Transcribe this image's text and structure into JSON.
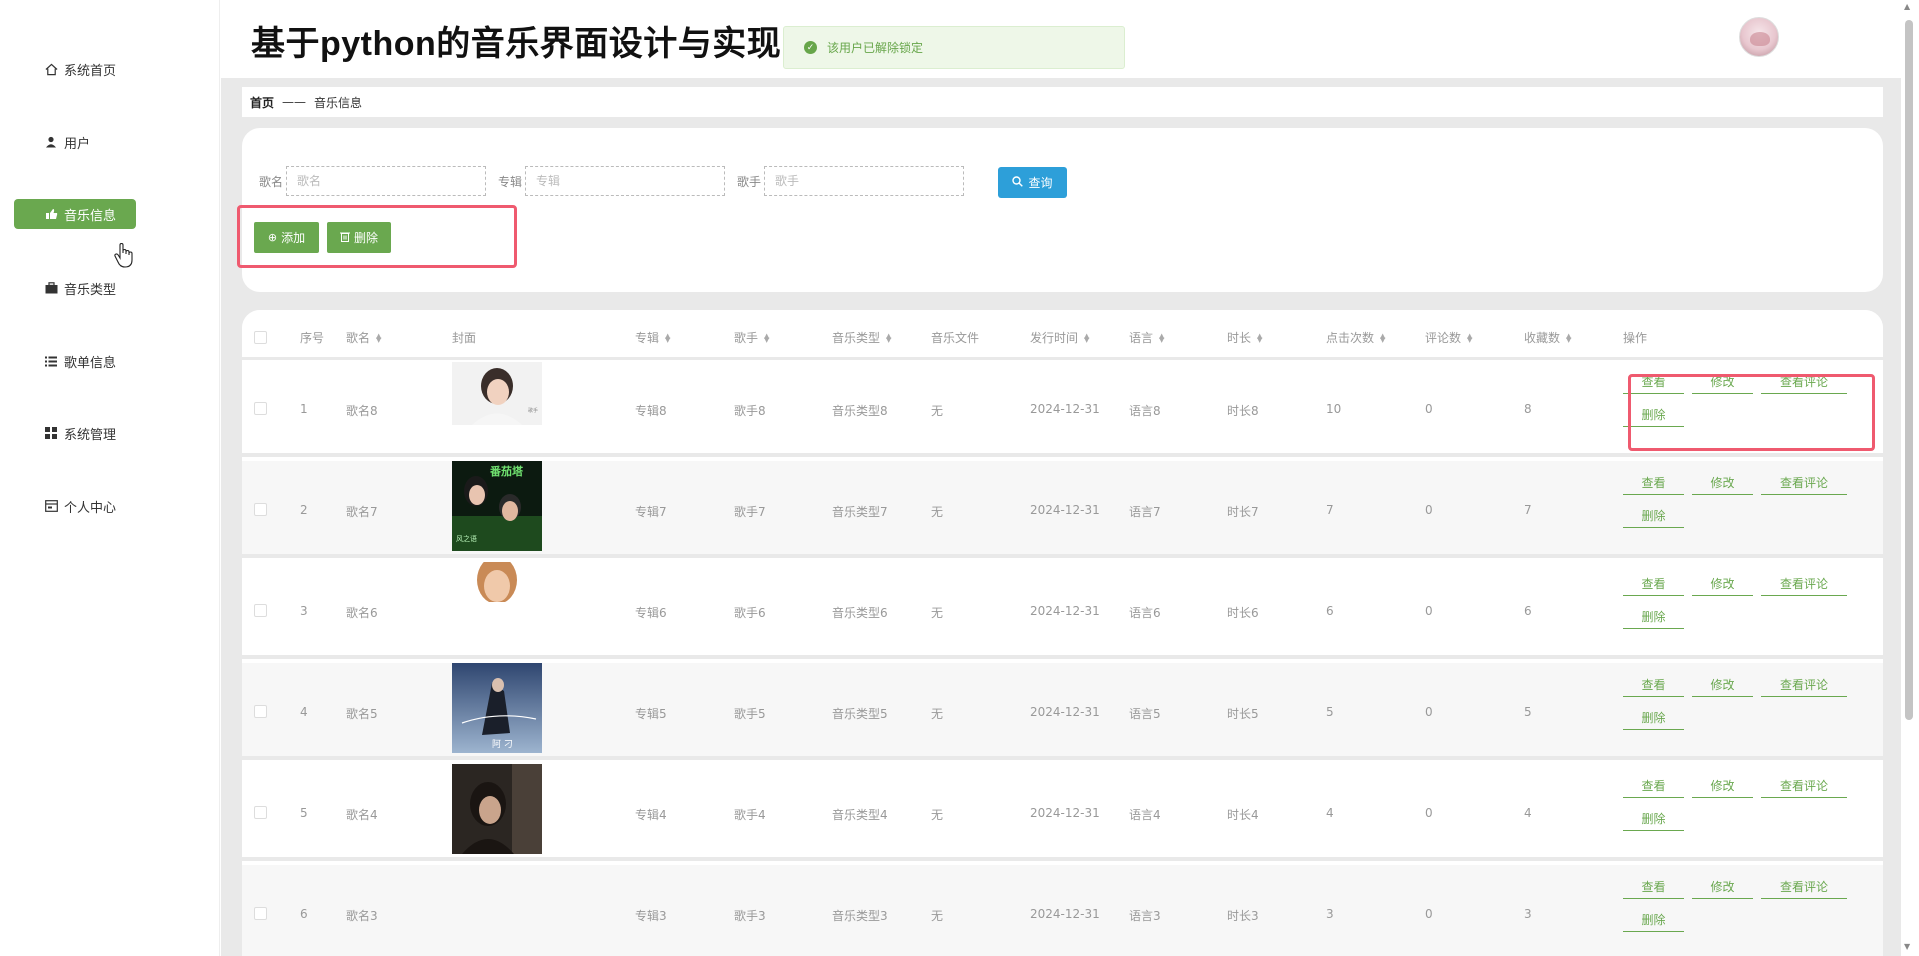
{
  "app": {
    "title": "基于python的音乐界面设计与实现",
    "toast": "该用户已解除锁定"
  },
  "sidebar": {
    "items": [
      {
        "label": "系统首页",
        "icon": "home-icon"
      },
      {
        "label": "用户",
        "icon": "user-icon"
      },
      {
        "label": "音乐信息",
        "icon": "music-icon",
        "active": true
      },
      {
        "label": "音乐类型",
        "icon": "briefcase-icon"
      },
      {
        "label": "歌单信息",
        "icon": "list-icon"
      },
      {
        "label": "系统管理",
        "icon": "grid-icon"
      },
      {
        "label": "个人中心",
        "icon": "card-icon"
      }
    ]
  },
  "breadcrumb": {
    "home": "首页",
    "separator": "——",
    "current": "音乐信息"
  },
  "search": {
    "name_label": "歌名",
    "name_placeholder": "歌名",
    "album_label": "专辑",
    "album_placeholder": "专辑",
    "singer_label": "歌手",
    "singer_placeholder": "歌手",
    "query_label": "查询"
  },
  "actions": {
    "add_label": "添加",
    "delete_label": "删除"
  },
  "table": {
    "headers": [
      "序号",
      "歌名",
      "封面",
      "专辑",
      "歌手",
      "音乐类型",
      "音乐文件",
      "发行时间",
      "语言",
      "时长",
      "点击次数",
      "评论数",
      "收藏数",
      "操作"
    ],
    "op_labels": {
      "view": "查看",
      "edit": "修改",
      "comments": "查看评论",
      "delete": "删除"
    },
    "rows": [
      {
        "no": "1",
        "name": "歌名8",
        "album": "专辑8",
        "singer": "歌手8",
        "type": "音乐类型8",
        "file": "无",
        "date": "2024-12-31",
        "lang": "语言8",
        "dur": "时长8",
        "clicks": "10",
        "comments": "0",
        "favs": "8"
      },
      {
        "no": "2",
        "name": "歌名7",
        "album": "专辑7",
        "singer": "歌手7",
        "type": "音乐类型7",
        "file": "无",
        "date": "2024-12-31",
        "lang": "语言7",
        "dur": "时长7",
        "clicks": "7",
        "comments": "0",
        "favs": "7"
      },
      {
        "no": "3",
        "name": "歌名6",
        "album": "专辑6",
        "singer": "歌手6",
        "type": "音乐类型6",
        "file": "无",
        "date": "2024-12-31",
        "lang": "语言6",
        "dur": "时长6",
        "clicks": "6",
        "comments": "0",
        "favs": "6"
      },
      {
        "no": "4",
        "name": "歌名5",
        "album": "专辑5",
        "singer": "歌手5",
        "type": "音乐类型5",
        "file": "无",
        "date": "2024-12-31",
        "lang": "语言5",
        "dur": "时长5",
        "clicks": "5",
        "comments": "0",
        "favs": "5"
      },
      {
        "no": "5",
        "name": "歌名4",
        "album": "专辑4",
        "singer": "歌手4",
        "type": "音乐类型4",
        "file": "无",
        "date": "2024-12-31",
        "lang": "语言4",
        "dur": "时长4",
        "clicks": "4",
        "comments": "0",
        "favs": "4"
      },
      {
        "no": "6",
        "name": "歌名3",
        "album": "专辑3",
        "singer": "歌手3",
        "type": "音乐类型3",
        "file": "无",
        "date": "2024-12-31",
        "lang": "语言3",
        "dur": "时长3",
        "clicks": "3",
        "comments": "0",
        "favs": "3"
      }
    ]
  },
  "colors": {
    "accent_green": "#6aa84f",
    "query_blue": "#2d9fd9",
    "highlight_red": "#ef5a6f"
  }
}
